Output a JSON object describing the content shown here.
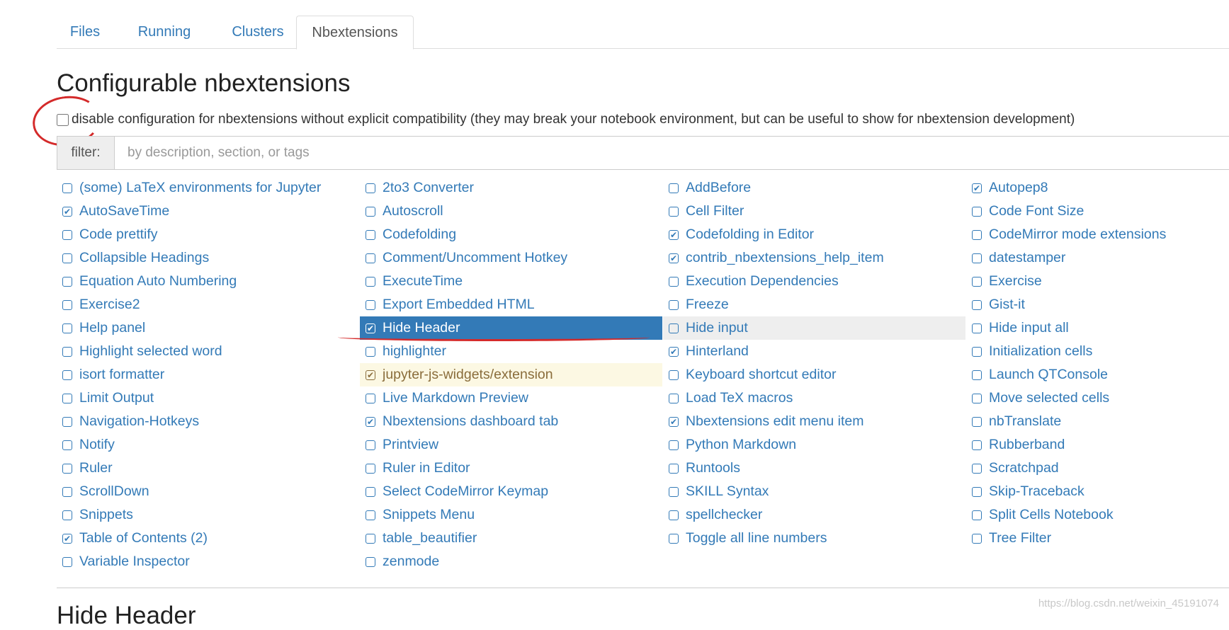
{
  "tabs": [
    {
      "label": "Files",
      "active": false
    },
    {
      "label": "Running",
      "active": false
    },
    {
      "label": "Clusters",
      "active": false
    },
    {
      "label": "Nbextensions",
      "active": true
    }
  ],
  "title": "Configurable nbextensions",
  "compat_checkbox": {
    "label": "disable configuration for nbextensions without explicit compatibility (they may break your notebook environment, but can be useful to show for nbextension development)",
    "checked": false
  },
  "filter": {
    "label": "filter:",
    "placeholder": "by description, section, or tags",
    "value": ""
  },
  "columns": [
    [
      {
        "label": "(some) LaTeX environments for Jupyter",
        "checked": false
      },
      {
        "label": "AutoSaveTime",
        "checked": true
      },
      {
        "label": "Code prettify",
        "checked": false
      },
      {
        "label": "Collapsible Headings",
        "checked": false
      },
      {
        "label": "Equation Auto Numbering",
        "checked": false
      },
      {
        "label": "Exercise2",
        "checked": false
      },
      {
        "label": "Help panel",
        "checked": false
      },
      {
        "label": "Highlight selected word",
        "checked": false
      },
      {
        "label": "isort formatter",
        "checked": false
      },
      {
        "label": "Limit Output",
        "checked": false
      },
      {
        "label": "Navigation-Hotkeys",
        "checked": false
      },
      {
        "label": "Notify",
        "checked": false
      },
      {
        "label": "Ruler",
        "checked": false
      },
      {
        "label": "ScrollDown",
        "checked": false
      },
      {
        "label": "Snippets",
        "checked": false
      },
      {
        "label": "Table of Contents (2)",
        "checked": true
      },
      {
        "label": "Variable Inspector",
        "checked": false
      }
    ],
    [
      {
        "label": "2to3 Converter",
        "checked": false
      },
      {
        "label": "Autoscroll",
        "checked": false
      },
      {
        "label": "Codefolding",
        "checked": false
      },
      {
        "label": "Comment/Uncomment Hotkey",
        "checked": false
      },
      {
        "label": "ExecuteTime",
        "checked": false
      },
      {
        "label": "Export Embedded HTML",
        "checked": false
      },
      {
        "label": "Hide Header",
        "checked": true,
        "state": "selected"
      },
      {
        "label": "highlighter",
        "checked": false
      },
      {
        "label": "jupyter-js-widgets/extension",
        "checked": true,
        "state": "warning"
      },
      {
        "label": "Live Markdown Preview",
        "checked": false
      },
      {
        "label": "Nbextensions dashboard tab",
        "checked": true
      },
      {
        "label": "Printview",
        "checked": false
      },
      {
        "label": "Ruler in Editor",
        "checked": false
      },
      {
        "label": "Select CodeMirror Keymap",
        "checked": false
      },
      {
        "label": "Snippets Menu",
        "checked": false
      },
      {
        "label": "table_beautifier",
        "checked": false
      },
      {
        "label": "zenmode",
        "checked": false
      }
    ],
    [
      {
        "label": "AddBefore",
        "checked": false
      },
      {
        "label": "Cell Filter",
        "checked": false
      },
      {
        "label": "Codefolding in Editor",
        "checked": true
      },
      {
        "label": "contrib_nbextensions_help_item",
        "checked": true
      },
      {
        "label": "Execution Dependencies",
        "checked": false
      },
      {
        "label": "Freeze",
        "checked": false
      },
      {
        "label": "Hide input",
        "checked": false,
        "state": "hover"
      },
      {
        "label": "Hinterland",
        "checked": true
      },
      {
        "label": "Keyboard shortcut editor",
        "checked": false
      },
      {
        "label": "Load TeX macros",
        "checked": false
      },
      {
        "label": "Nbextensions edit menu item",
        "checked": true
      },
      {
        "label": "Python Markdown",
        "checked": false
      },
      {
        "label": "Runtools",
        "checked": false
      },
      {
        "label": "SKILL Syntax",
        "checked": false
      },
      {
        "label": "spellchecker",
        "checked": false
      },
      {
        "label": "Toggle all line numbers",
        "checked": false
      }
    ],
    [
      {
        "label": "Autopep8",
        "checked": true
      },
      {
        "label": "Code Font Size",
        "checked": false
      },
      {
        "label": "CodeMirror mode extensions",
        "checked": false
      },
      {
        "label": "datestamper",
        "checked": false
      },
      {
        "label": "Exercise",
        "checked": false
      },
      {
        "label": "Gist-it",
        "checked": false
      },
      {
        "label": "Hide input all",
        "checked": false
      },
      {
        "label": "Initialization cells",
        "checked": false
      },
      {
        "label": "Launch QTConsole",
        "checked": false
      },
      {
        "label": "Move selected cells",
        "checked": false
      },
      {
        "label": "nbTranslate",
        "checked": false
      },
      {
        "label": "Rubberband",
        "checked": false
      },
      {
        "label": "Scratchpad",
        "checked": false
      },
      {
        "label": "Skip-Traceback",
        "checked": false
      },
      {
        "label": "Split Cells Notebook",
        "checked": false
      },
      {
        "label": "Tree Filter",
        "checked": false
      }
    ]
  ],
  "section_title": "Hide Header",
  "watermark": "https://blog.csdn.net/weixin_45191074",
  "colors": {
    "link": "#337ab7",
    "selected_bg": "#337ab7",
    "warning_bg": "#fcf8e3",
    "warning_text": "#8a6d3b",
    "annotation": "#d42a2a"
  }
}
